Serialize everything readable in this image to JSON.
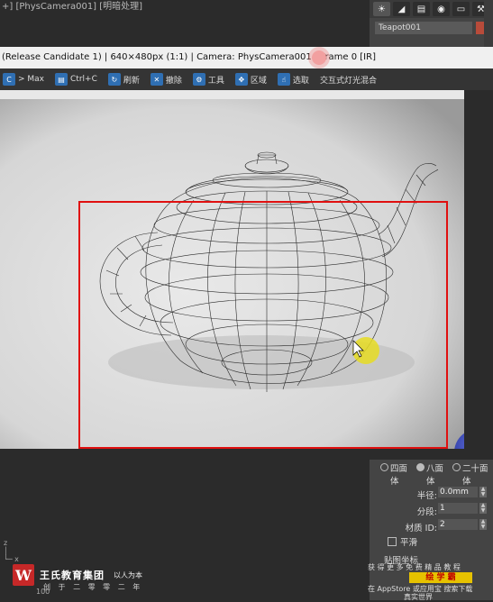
{
  "viewport": {
    "label": "+] [PhysCamera001] [明暗处理]"
  },
  "command_panel": {
    "tabs": [
      "☀",
      "◢",
      "▤",
      "◉",
      "▭",
      "⚒"
    ],
    "object_name": "Teapot001",
    "object_color": "#b84b3a"
  },
  "render_window": {
    "title": "(Release Candidate 1) | 640×480px (1:1) | Camera: PhysCamera001 | Frame 0 [IR]",
    "toolbar": [
      {
        "icon": "C",
        "label": "> Max"
      },
      {
        "icon": "▤",
        "label": "Ctrl+C"
      },
      {
        "icon": "↻",
        "label": "刷新"
      },
      {
        "icon": "✕",
        "label": "撤除"
      },
      {
        "icon": "⚙",
        "label": "工具"
      },
      {
        "icon": "✥",
        "label": "区域"
      },
      {
        "icon": "☝",
        "label": "选取"
      },
      {
        "icon": "",
        "label": "交互式灯光混合"
      }
    ]
  },
  "params": {
    "segment_options": [
      "四面体",
      "八面体",
      "二十面体"
    ],
    "segment_selected": 1,
    "radius_label": "半径:",
    "radius_value": "0.0mm",
    "segments_label": "分段:",
    "segments_value": "1",
    "material_id_label": "材质 ID:",
    "material_id_value": "2",
    "smooth_label": "平滑",
    "section_label": "贴图坐标",
    "watermark_line1": "获 得 更 多 免 费 精 品 教 程",
    "watermark_button": "绘 学 霸",
    "watermark_line2": "在 AppStore 或应用宝 搜索下载",
    "bottom_label": "真实世界"
  },
  "logo": {
    "badge": "W",
    "name": "王氏教育集团",
    "tagline": "以人为本",
    "founded": "创 于 二 零 零 二 年",
    "coord": "100"
  }
}
